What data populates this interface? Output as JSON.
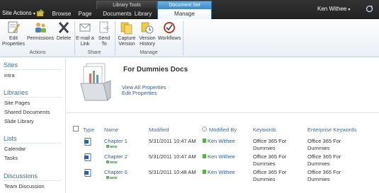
{
  "topbar": {
    "site_actions": "Site Actions",
    "tabs": {
      "browse": "Browse",
      "page": "Page",
      "documents": "Documents",
      "library": "Library",
      "manage": "Manage"
    },
    "tool_groups": {
      "library_tools": "Library Tools",
      "document_set": "Document Set"
    },
    "user": "Ken Withee"
  },
  "ribbon": {
    "buttons": {
      "edit_properties": "Edit Properties",
      "permissions": "Permissions",
      "delete": "Delete",
      "email_link": "E-mail a Link",
      "send_to": "Send To",
      "capture_version": "Capture Version",
      "version_history": "Version History",
      "workflows": "Workflows"
    },
    "groups": {
      "actions": "Actions",
      "share": "Share",
      "manage": "Manage"
    }
  },
  "leftnav": {
    "sites_heading": "Sites",
    "sites": [
      "intra"
    ],
    "libraries_heading": "Libraries",
    "libraries": [
      "Site Pages",
      "Shared Documents",
      "Slide Library"
    ],
    "lists_heading": "Lists",
    "lists": [
      "Calendar",
      "Tasks"
    ],
    "discussions_heading": "Discussions",
    "discussions": [
      "Team Discussion"
    ]
  },
  "docset": {
    "title": "For Dummies Docs",
    "view_all": "View All Properties",
    "edit": "Edit Properties"
  },
  "table": {
    "headers": {
      "type": "Type",
      "name": "Name",
      "modified": "Modified",
      "modified_by": "Modified By",
      "keywords": "Keywords",
      "enterprise_keywords": "Enterprise Keywords"
    },
    "new_badge": "NEW",
    "rows": [
      {
        "name": "Chapter 1",
        "modified": "5/31/2011 10:47 AM",
        "modified_by": "Ken Withee",
        "keywords": "Office 365 For Dummies",
        "enterprise_keywords": "Office 365 For Dummies"
      },
      {
        "name": "Chapter 2",
        "modified": "5/31/2011 10:47 AM",
        "modified_by": "Ken Withee",
        "keywords": "Office 365 For Dummies",
        "enterprise_keywords": "Office 365 For Dummies"
      },
      {
        "name": "Chapter 6",
        "modified": "5/31/2011 10:48 AM",
        "modified_by": "Ken Withee",
        "keywords": "Office 365 For Dummies",
        "enterprise_keywords": "Office 365 For Dummies"
      }
    ]
  }
}
